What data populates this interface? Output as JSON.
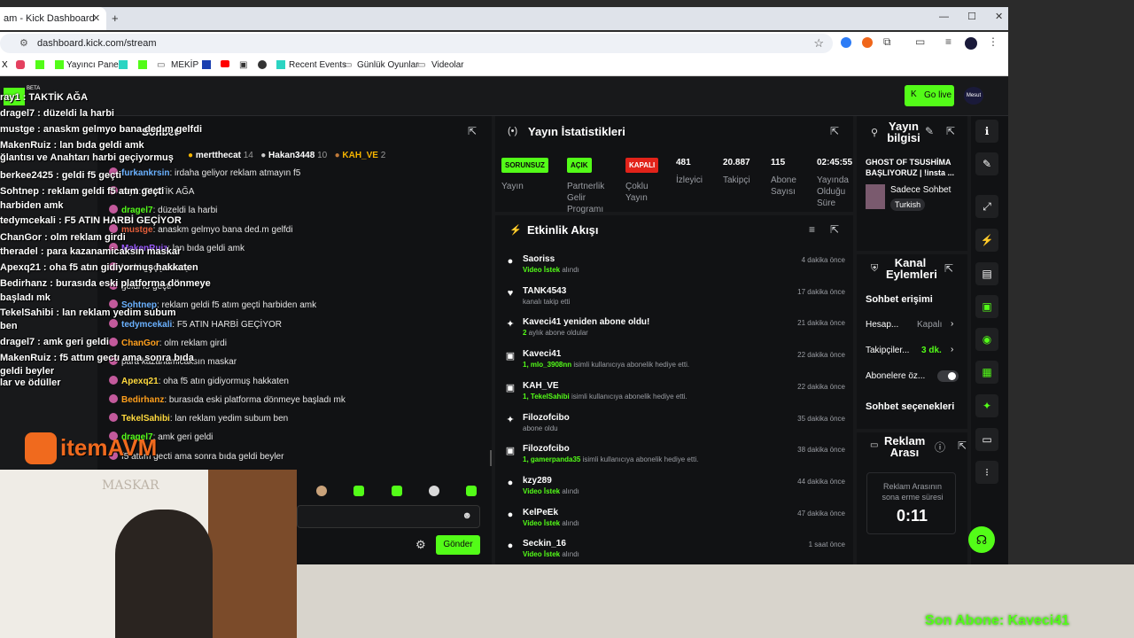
{
  "browser": {
    "tab_title": "am - Kick Dashboard",
    "new_tab": "+",
    "url": "dashboard.kick.com/stream",
    "bookmarks": [
      "Yayıncı Paneli",
      "MEKİP",
      "Recent Events",
      "Günlük Oyunlar",
      "Videolar"
    ],
    "window_controls": [
      "—",
      "☐",
      "✕"
    ]
  },
  "header": {
    "beta": "BETA",
    "go_live": "Go live",
    "avatar": "Mesut"
  },
  "chat_panel": {
    "title": "Sohbet",
    "top_chatters": [
      {
        "name": "mertthecat",
        "count": "14"
      },
      {
        "name": "Hakan3448",
        "count": "10"
      },
      {
        "name": "KAH_VE",
        "count": "2"
      }
    ],
    "lines": [
      {
        "user": "furkankrsin",
        "text": ": irdaha geliyor reklam atmayın f5",
        "color": "#6ab1ff"
      },
      {
        "user": "",
        "text": "ray1: TAKTİK AĞA",
        "color": "#53fc18"
      },
      {
        "user": "dragel7",
        "text": ": düzeldi la harbi",
        "color": "#53fc18"
      },
      {
        "user": "mustge",
        "text": ": anaskm gelmyo bana ded.m gelfdi",
        "color": "#e05d3a"
      },
      {
        "user": "MakenRuiz",
        "text": ": lan bıda geldi amk",
        "color": "#9b59ff"
      },
      {
        "user": "",
        "text": "harbi geçiyormuş",
        "color": "#fff"
      },
      {
        "user": "",
        "text": "geldi f5 geçti",
        "color": "#fff"
      },
      {
        "user": "Sohtnep",
        "text": ": reklam geldi f5 atım geçti harbiden amk",
        "color": "#6ab1ff"
      },
      {
        "user": "tedymcekali",
        "text": ": F5 ATIN HARBİ GEÇİYOR",
        "color": "#6ab1ff"
      },
      {
        "user": "ChanGor",
        "text": ": olm reklam girdi",
        "color": "#ff9f1c"
      },
      {
        "user": "",
        "text": "para kazanamicaksın maskar",
        "color": "#fff"
      },
      {
        "user": "Apexq21",
        "text": ": oha f5 atın gidiyormuş hakkaten",
        "color": "#ffd93d"
      },
      {
        "user": "Bedirhanz",
        "text": ": burasıda eski platforma dönmeye başladı mk",
        "color": "#ff9f1c"
      },
      {
        "user": "TekelSahibi",
        "text": ": lan reklam yedim subum ben",
        "color": "#ffd93d"
      },
      {
        "user": "dragel7",
        "text": ": amk geri geldi",
        "color": "#53fc18"
      },
      {
        "user": "",
        "text": "f5 attım gecti ama sonra bıda geldi beyler",
        "color": "#fff"
      }
    ],
    "send": "Gönder"
  },
  "overlay_chat": [
    "ray1 : TAKTİK AĞA",
    "dragel7 : düzeldi la harbi",
    "mustge : anaskm gelmyo bana ded.m gelfdi",
    "MakenRuiz : lan bıda geldi amk",
    "ğlantısı ve Anahtarı  harbi geçiyormuş",
    "berkee2425 : geldi f5 geçti",
    "Sohtnep : reklam geldi f5 atım geçti",
    "harbiden amk",
    "tedymcekali : F5 ATIN HARBİ GEÇİYOR",
    "ChanGor : olm reklam girdi",
    "theradel : para kazanamicaksın maskar",
    "Apexq21 : oha f5 atın gidiyormuş hakkaten",
    "Bedirhanz : burasıda eski platforma dönmeye",
    "başladı mk",
    "TekelSahibi : lan reklam yedim subum",
    "ben",
    "dragel7 : amk geri geldi",
    "MakenRuiz : f5 attım gectı ama sonra bıda",
    "geldi beyler",
    "lar ve ödüller"
  ],
  "stats": {
    "title": "Yayın İstatistikleri",
    "items": [
      {
        "badge": "SORUNSUZ",
        "badge_color": "#53fc18",
        "label": "Yayın"
      },
      {
        "badge": "AÇIK",
        "badge_color": "#53fc18",
        "label": "Partnerlik Gelir Programı"
      },
      {
        "badge": "KAPALI",
        "badge_color": "#e2231a",
        "label": "Çoklu Yayın"
      },
      {
        "value": "481",
        "label": "İzleyici"
      },
      {
        "value": "20.887",
        "label": "Takipçi"
      },
      {
        "value": "115",
        "label": "Abone Sayısı"
      },
      {
        "value": "02:45:55",
        "label": "Yayında Olduğu Süre"
      }
    ]
  },
  "activity": {
    "title": "Etkinlik Akışı",
    "events": [
      {
        "name": "Saoriss",
        "sub_hl": "Video İstek",
        "sub": " alındı",
        "time": "4 dakika önce",
        "icon": "●"
      },
      {
        "name": "TANK4543",
        "sub_hl": "",
        "sub": "kanalı takip etti",
        "time": "17 dakika önce",
        "icon": "♥"
      },
      {
        "name": "Kaveci41 yeniden abone oldu!",
        "sub_hl": "2",
        "sub": " aylık abone oldular",
        "time": "21 dakika önce",
        "icon": "✦"
      },
      {
        "name": "Kaveci41",
        "sub_hl": "1, mlo_3908nn",
        "sub": " isimli kullanıcıya abonelik hediye etti.",
        "time": "22 dakika önce",
        "icon": "▣"
      },
      {
        "name": "KAH_VE",
        "sub_hl": "1, TekelSahibi",
        "sub": " isimli kullanıcıya abonelik hediye etti.",
        "time": "22 dakika önce",
        "icon": "▣"
      },
      {
        "name": "Filozofcibo",
        "sub_hl": "",
        "sub": "abone oldu",
        "time": "35 dakika önce",
        "icon": "✦"
      },
      {
        "name": "Filozofcibo",
        "sub_hl": "1, gamerpanda35",
        "sub": " isimli kullanıcıya abonelik hediye etti.",
        "time": "38 dakika önce",
        "icon": "▣"
      },
      {
        "name": "kzy289",
        "sub_hl": "Video İstek",
        "sub": " alındı",
        "time": "44 dakika önce",
        "icon": "●"
      },
      {
        "name": "KelPeEk",
        "sub_hl": "Video İstek",
        "sub": " alındı",
        "time": "47 dakika önce",
        "icon": "●"
      },
      {
        "name": "Seckin_16",
        "sub_hl": "Video İstek",
        "sub": " alındı",
        "time": "1 saat önce",
        "icon": "●"
      }
    ]
  },
  "info": {
    "title": "Yayın bilgisi",
    "stream_title": "GHOST OF TSUSHİMA BAŞLIYORUZ | !insta ...",
    "category": "Sadece Sohbet",
    "language": "Turkish"
  },
  "mod": {
    "title": "Kanal Eylemleri",
    "chat_access": "Sohbet erişimi",
    "rows": [
      {
        "label": "Hesap...",
        "value": "Kapalı"
      },
      {
        "label": "Takipçiler...",
        "value": "3 dk."
      }
    ],
    "subs_only": "Abonelere öz...",
    "chat_options": "Sohbet seçenekleri"
  },
  "ad": {
    "title": "Reklam Arası",
    "label": "Reklam Arasının sona erme süresi",
    "timer": "0:11"
  },
  "stream_overlay": {
    "logo": "itemAVM",
    "last_sub": "Son Abone: Kaveci41",
    "poster": "MASKAR"
  }
}
